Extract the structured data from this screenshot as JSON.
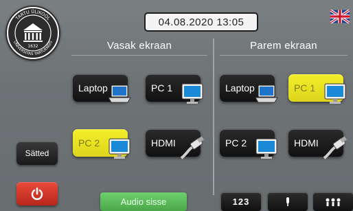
{
  "header": {
    "datetime": "04.08.2020 13:05",
    "language_icon": "uk-flag-icon"
  },
  "logo": {
    "top_text": "TARTU ÜLIKOOL",
    "bottom_text": "UNIVERSITAS TARTUENSIS",
    "year": "1632",
    "icon": "university-seal-icon"
  },
  "sidebar": {
    "settings_label": "Sätted",
    "power_icon": "power-icon"
  },
  "left_screen": {
    "title": "Vasak ekraan",
    "sources": [
      {
        "label": "Laptop",
        "icon": "laptop-icon",
        "active": false
      },
      {
        "label": "PC 1",
        "icon": "monitor-icon",
        "active": false
      },
      {
        "label": "PC 2",
        "icon": "monitor-icon",
        "active": true
      },
      {
        "label": "HDMI",
        "icon": "hdmi-cable-icon",
        "active": false
      }
    ]
  },
  "right_screen": {
    "title": "Parem ekraan",
    "sources": [
      {
        "label": "Laptop",
        "icon": "laptop-icon",
        "active": false
      },
      {
        "label": "PC 1",
        "icon": "monitor-icon",
        "active": true
      },
      {
        "label": "PC 2",
        "icon": "monitor-icon",
        "active": false
      },
      {
        "label": "HDMI",
        "icon": "hdmi-cable-icon",
        "active": false
      }
    ]
  },
  "bottom": {
    "audio_label": "Audio sisse",
    "numeric_label": "123",
    "tools": [
      "microphone-icon",
      "group-icon"
    ]
  },
  "colors": {
    "active_source": "#f0eb27",
    "audio_green": "#5cc05a",
    "power_red": "#d63a2b"
  }
}
